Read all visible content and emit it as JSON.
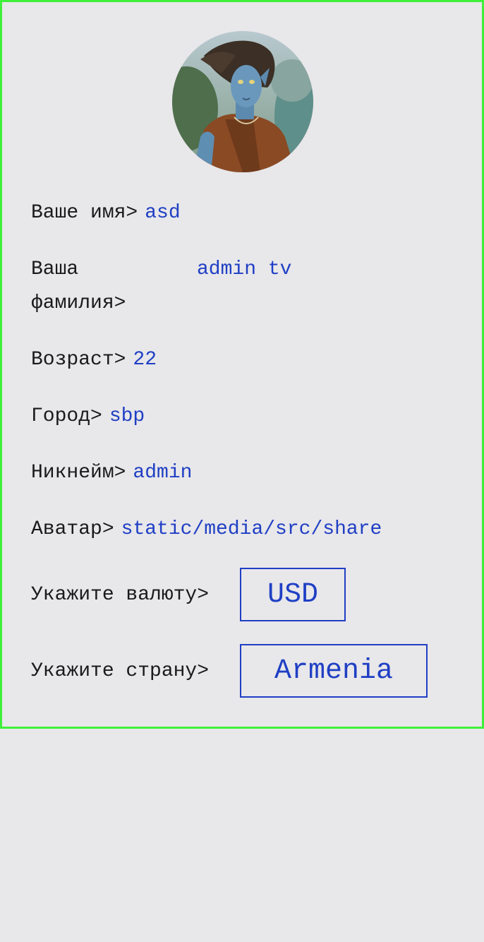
{
  "profile": {
    "name_label": "Ваше имя>",
    "name_value": "asd",
    "surname_label": "Ваша фамилия>",
    "surname_value": "admin tv",
    "age_label": "Возраст>",
    "age_value": "22",
    "city_label": "Город>",
    "city_value": "sbp",
    "nickname_label": "Никнейм>",
    "nickname_value": "admin",
    "avatar_label": "Аватар>",
    "avatar_value": "static/media/src/share"
  },
  "selects": {
    "currency_label": "Укажите валюту>",
    "currency_value": "USD",
    "country_label": "Укажите страну>",
    "country_value": "Armenia"
  },
  "colors": {
    "border": "#3ef03a",
    "value": "#1f3fc4",
    "background": "#e8e7ea"
  },
  "icons": {
    "avatar": "profile-photo"
  }
}
